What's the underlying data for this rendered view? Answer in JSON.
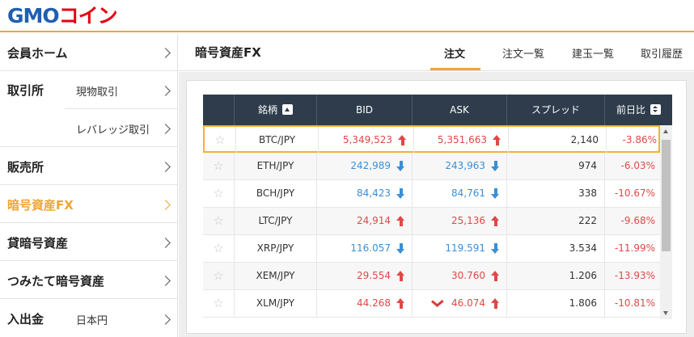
{
  "app": {
    "logo_gmo": "GMO",
    "logo_coin": "コイン"
  },
  "sidebar": {
    "items": [
      {
        "label": "会員ホーム",
        "sub": ""
      },
      {
        "label": "取引所",
        "sub": "現物取引"
      },
      {
        "label": "",
        "sub": "レバレッジ取引"
      },
      {
        "label": "販売所",
        "sub": ""
      },
      {
        "label": "暗号資産FX",
        "sub": ""
      },
      {
        "label": "貸暗号資産",
        "sub": ""
      },
      {
        "label": "つみたて暗号資産",
        "sub": ""
      },
      {
        "label": "入出金",
        "sub": "日本円"
      }
    ],
    "active_index": 4
  },
  "header": {
    "title": "暗号資産FX",
    "tabs": [
      {
        "label": "注文",
        "active": true
      },
      {
        "label": "注文一覧",
        "active": false
      },
      {
        "label": "建玉一覧",
        "active": false
      },
      {
        "label": "取引履歴",
        "active": false
      }
    ]
  },
  "table": {
    "columns": [
      "銘柄",
      "BID",
      "ASK",
      "スプレッド",
      "前日比"
    ],
    "rows": [
      {
        "name": "BTC/JPY",
        "bid": "5,349,523",
        "bid_dir": "up",
        "ask": "5,351,663",
        "ask_dir": "up",
        "spread": "2,140",
        "change": "-3.86%"
      },
      {
        "name": "ETH/JPY",
        "bid": "242,989",
        "bid_dir": "down",
        "ask": "243,963",
        "ask_dir": "down",
        "spread": "974",
        "change": "-6.03%"
      },
      {
        "name": "BCH/JPY",
        "bid": "84,423",
        "bid_dir": "down",
        "ask": "84,761",
        "ask_dir": "down",
        "spread": "338",
        "change": "-10.67%"
      },
      {
        "name": "LTC/JPY",
        "bid": "24,914",
        "bid_dir": "up",
        "ask": "25,136",
        "ask_dir": "up",
        "spread": "222",
        "change": "-9.68%"
      },
      {
        "name": "XRP/JPY",
        "bid": "116.057",
        "bid_dir": "down",
        "ask": "119.591",
        "ask_dir": "down",
        "spread": "3.534",
        "change": "-11.99%"
      },
      {
        "name": "XEM/JPY",
        "bid": "29.554",
        "bid_dir": "up",
        "ask": "30.760",
        "ask_dir": "up",
        "spread": "1.206",
        "change": "-13.93%"
      },
      {
        "name": "XLM/JPY",
        "bid": "44.268",
        "bid_dir": "up",
        "ask": "46.074",
        "ask_dir": "up",
        "spread": "1.806",
        "change": "-10.81%"
      }
    ],
    "selected_index": 0
  },
  "colors": {
    "accent": "#f1a436",
    "up": "#e04848",
    "down": "#3a8fd6",
    "header_bg": "#2e3c4c"
  }
}
